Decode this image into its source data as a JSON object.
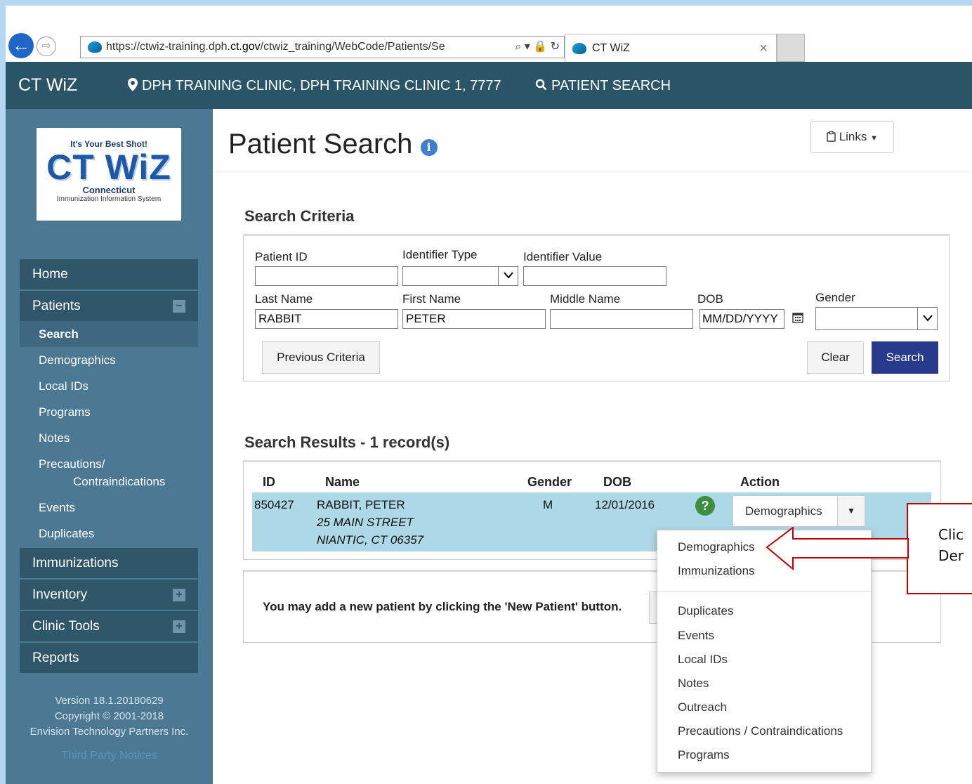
{
  "browser": {
    "url_scheme": "https://",
    "url_pre": "ctwiz-training.dph.",
    "url_domain": "ct.gov",
    "url_post": "/ctwiz_training/WebCode/Patients/Se",
    "tools": "⌕ ▾ 🔒 ↻",
    "tab_title": "CT WiZ",
    "tab_close": "×"
  },
  "header": {
    "app_title": "CT WiZ",
    "clinic": "DPH TRAINING CLINIC, DPH TRAINING CLINIC 1, 7777",
    "patient_search": "PATIENT SEARCH"
  },
  "logo": {
    "tagline": "It's Your Best Shot!",
    "name": "CT WiZ",
    "state": "Connecticut",
    "subtitle": "Immunization Information System"
  },
  "sidebar": {
    "home": "Home",
    "patients": "Patients",
    "patients_toggle": "−",
    "patient_items": [
      "Search",
      "Demographics",
      "Local IDs",
      "Programs",
      "Notes"
    ],
    "precautions_1": "Precautions/",
    "precautions_2": "Contraindications",
    "patient_items_2": [
      "Events",
      "Duplicates"
    ],
    "immunizations": "Immunizations",
    "inventory": "Inventory",
    "inventory_toggle": "+",
    "clinic_tools": "Clinic Tools",
    "clinic_tools_toggle": "+",
    "reports": "Reports",
    "version": "Version 18.1.20180629",
    "copyright": "Copyright © 2001-2018",
    "company": "Envision Technology Partners Inc.",
    "third_party": "Third Party Notices"
  },
  "page": {
    "title": "Patient Search",
    "links_label": "Links",
    "search_criteria_title": "Search Criteria",
    "results_title": "Search Results - 1 record(s)"
  },
  "form": {
    "patient_id_label": "Patient ID",
    "patient_id_value": "",
    "identifier_type_label": "Identifier Type",
    "identifier_type_value": "",
    "identifier_value_label": "Identifier Value",
    "identifier_value_value": "",
    "last_name_label": "Last Name",
    "last_name_value": "RABBIT",
    "first_name_label": "First Name",
    "first_name_value": "PETER",
    "middle_name_label": "Middle Name",
    "middle_name_value": "",
    "dob_label": "DOB",
    "dob_placeholder": "MM/DD/YYYY",
    "gender_label": "Gender",
    "gender_value": "",
    "previous_criteria": "Previous Criteria",
    "clear": "Clear",
    "search": "Search"
  },
  "results": {
    "columns": [
      "ID",
      "Name",
      "Gender",
      "DOB",
      "Action"
    ],
    "rows": [
      {
        "id": "850427",
        "name": "RABBIT, PETER",
        "address1": "25 MAIN STREET",
        "address2": "NIANTIC, CT 06357",
        "gender": "M",
        "dob": "12/01/2016",
        "action": "Demographics"
      }
    ]
  },
  "action_menu": {
    "group1": [
      "Demographics",
      "Immunizations"
    ],
    "group2": [
      "Duplicates",
      "Events",
      "Local IDs",
      "Notes",
      "Outreach",
      "Precautions / Contraindications",
      "Programs"
    ]
  },
  "new_patient": {
    "message": "You may add a new patient by clicking the 'New Patient' button."
  },
  "callout": {
    "line1": "Clic",
    "line2": "Der"
  },
  "colors": {
    "header": "#2c5468",
    "sidebar": "#4b7892",
    "menu": "#2f5669",
    "primary_button": "#283a8c",
    "row_highlight": "#add8e6",
    "callout": "#c00000"
  }
}
